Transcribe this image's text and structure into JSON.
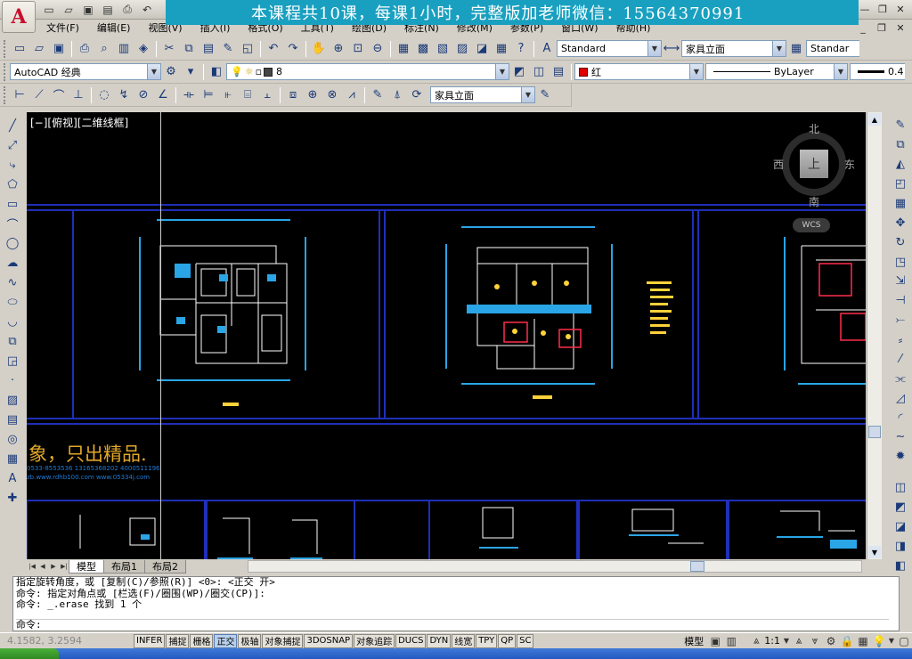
{
  "window": {
    "banner_text": "本课程共10课，每课1小时，完整版加老师微信：15564370991"
  },
  "menubar": {
    "items": [
      "文件(F)",
      "编辑(E)",
      "视图(V)",
      "插入(I)",
      "格式(O)",
      "工具(T)",
      "绘图(D)",
      "标注(N)",
      "修改(M)",
      "参数(P)",
      "窗口(W)",
      "帮助(H)"
    ]
  },
  "toolbar1": {
    "text_style": "Standard",
    "dim_style": "家具立面",
    "table_style": "Standar"
  },
  "toolbar2": {
    "workspace": "AutoCAD 经典",
    "layer": "8",
    "color": "红",
    "linetype": "ByLayer",
    "lineweight": "0.4"
  },
  "toolbar3": {
    "dim_style": "家具立面"
  },
  "viewport": {
    "label": "[−][俯视][二维线框]",
    "viewcube": {
      "top_face": "上",
      "north": "北",
      "south": "南",
      "east": "东",
      "west": "西"
    },
    "wcs": "WCS",
    "ad_text": "象，只出精品.",
    "ad_line1": "0533-8553536  13165368202  4000511196",
    "ad_line2": "zb.www.rdhb100.com  www.05334j.com"
  },
  "layout_tabs": [
    "模型",
    "布局1",
    "布局2"
  ],
  "command_history": [
    "指定旋转角度，或 [复制(C)/参照(R)] <0>:   <正交 开>",
    "命令: 指定对角点或 [栏选(F)/圈围(WP)/圈交(CP)]:",
    "命令: _.erase 找到 1 个"
  ],
  "command_prompt": "命令:",
  "statusbar": {
    "coords": "4.1582,  3.2594",
    "toggles": [
      {
        "label": "INFER",
        "on": false
      },
      {
        "label": "捕捉",
        "on": false
      },
      {
        "label": "栅格",
        "on": false
      },
      {
        "label": "正交",
        "on": true
      },
      {
        "label": "极轴",
        "on": false
      },
      {
        "label": "对象捕捉",
        "on": false
      },
      {
        "label": "3DOSNAP",
        "on": false
      },
      {
        "label": "对象追踪",
        "on": false
      },
      {
        "label": "DUCS",
        "on": false
      },
      {
        "label": "DYN",
        "on": false
      },
      {
        "label": "线宽",
        "on": false
      },
      {
        "label": "TPY",
        "on": false
      },
      {
        "label": "QP",
        "on": false
      },
      {
        "label": "SC",
        "on": false
      }
    ],
    "model_label": "模型",
    "scale": "1:1"
  },
  "colors": {
    "canvas": "#000000",
    "blueprint": "#1f2fb8",
    "dim": "#2aa5e6",
    "accent": "#e2a72a"
  }
}
